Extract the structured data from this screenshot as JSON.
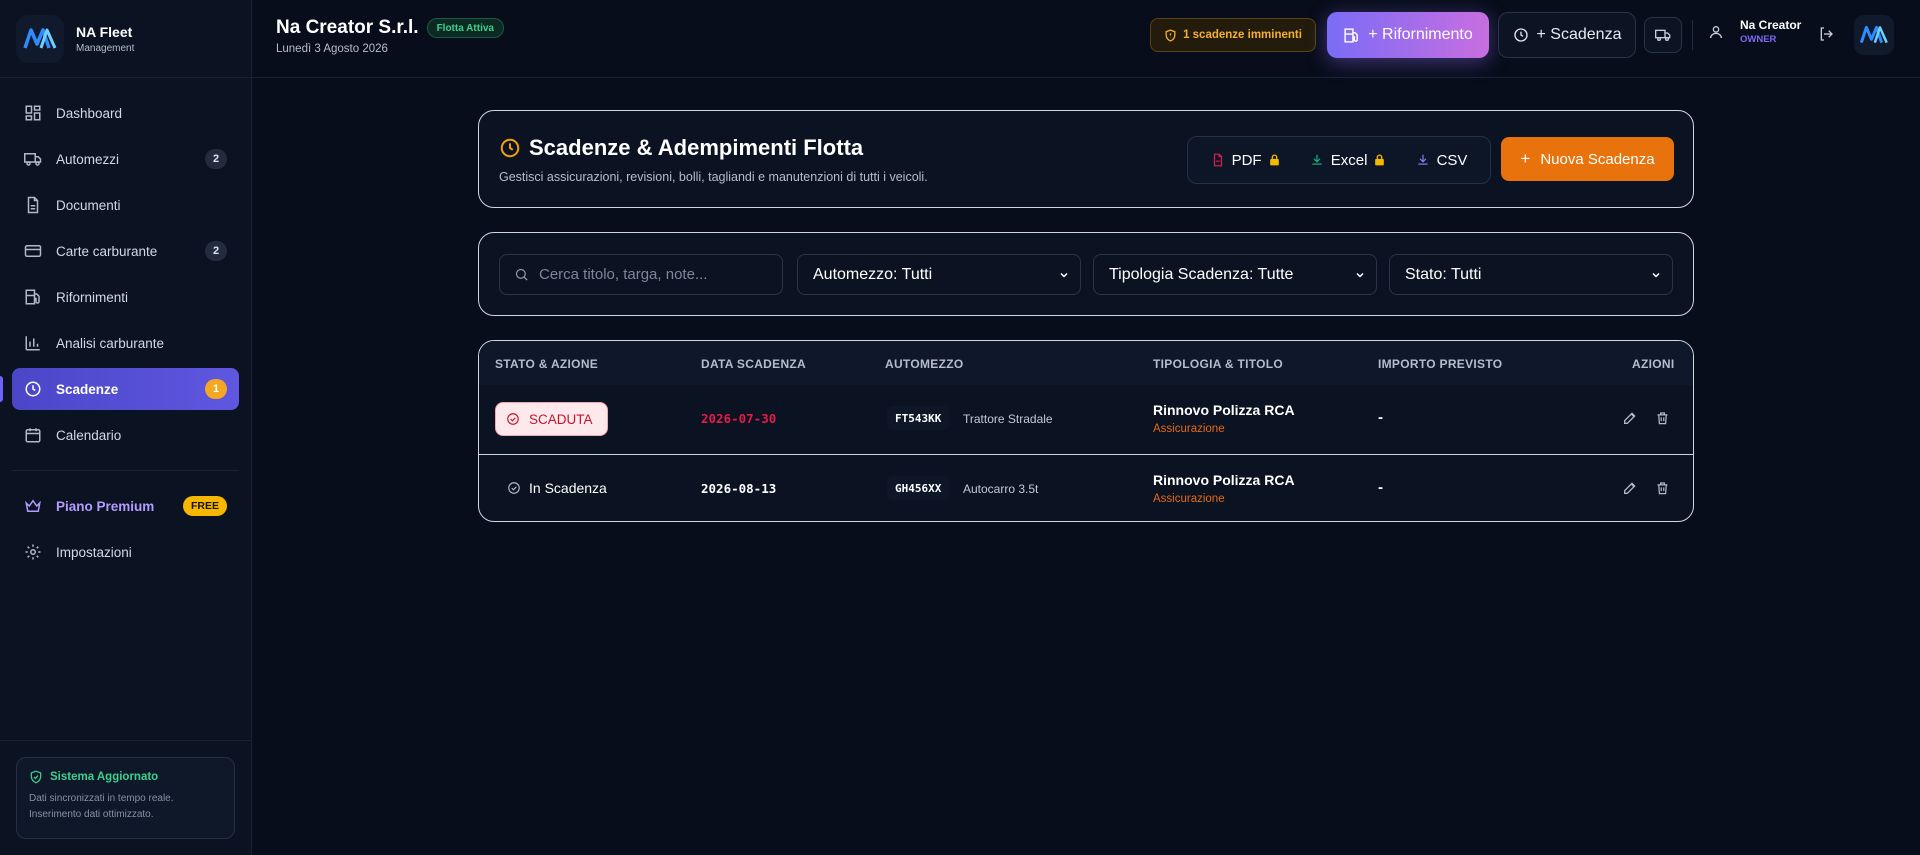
{
  "brand": {
    "name": "NA Fleet",
    "sub": "Management"
  },
  "sidebar": {
    "items": [
      {
        "label": "Dashboard"
      },
      {
        "label": "Automezzi",
        "badge": "2"
      },
      {
        "label": "Documenti"
      },
      {
        "label": "Carte carburante",
        "badge": "2"
      },
      {
        "label": "Rifornimenti"
      },
      {
        "label": "Analisi carburante"
      },
      {
        "label": "Scadenze",
        "badge": "1",
        "active": true
      },
      {
        "label": "Calendario"
      }
    ],
    "premium": {
      "label": "Piano Premium",
      "badge": "FREE"
    },
    "settings": {
      "label": "Impostazioni"
    },
    "system": {
      "title": "Sistema Aggiornato",
      "desc1": "Dati sincronizzati in tempo reale.",
      "desc2": "Inserimento dati ottimizzato."
    }
  },
  "topbar": {
    "company": "Na Creator S.r.l.",
    "fleet_status": "Flotta Attiva",
    "date": "Lunedì 3 Agosto 2026",
    "warning": "1 scadenze imminenti",
    "refuel_button": "+ Rifornimento",
    "deadline_button": "+ Scadenza",
    "user_name": "Na Creator",
    "user_role": "OWNER"
  },
  "page": {
    "title": "Scadenze & Adempimenti Flotta",
    "description": "Gestisci assicurazioni, revisioni, bolli, tagliandi e manutenzioni di tutti i veicoli.",
    "export": {
      "pdf": "PDF",
      "excel": "Excel",
      "csv": "CSV"
    },
    "new_button": "Nuova Scadenza"
  },
  "filters": {
    "search_placeholder": "Cerca titolo, targa, note...",
    "vehicle": "Automezzo: Tutti",
    "type": "Tipologia Scadenza: Tutte",
    "status": "Stato: Tutti"
  },
  "table": {
    "headers": [
      "STATO & AZIONE",
      "DATA SCADENZA",
      "AUTOMEZZO",
      "TIPOLOGIA & TITOLO",
      "IMPORTO PREVISTO",
      "AZIONI"
    ],
    "rows": [
      {
        "status": "SCADUTA",
        "date": "2026-07-30",
        "plate": "FT543KK",
        "vehicle": "Trattore Stradale",
        "title": "Rinnovo Polizza RCA",
        "category": "Assicurazione",
        "amount": "-"
      },
      {
        "status": "In Scadenza",
        "date": "2026-08-13",
        "plate": "GH456XX",
        "vehicle": "Autocarro 3.5t",
        "title": "Rinnovo Polizza RCA",
        "category": "Assicurazione",
        "amount": "-"
      }
    ]
  },
  "colors": {
    "accent": "#5f57e0",
    "orange": "#e8730c",
    "expired": "#c5152e",
    "success": "#3ecf8e",
    "warning": "#f5b12b"
  }
}
